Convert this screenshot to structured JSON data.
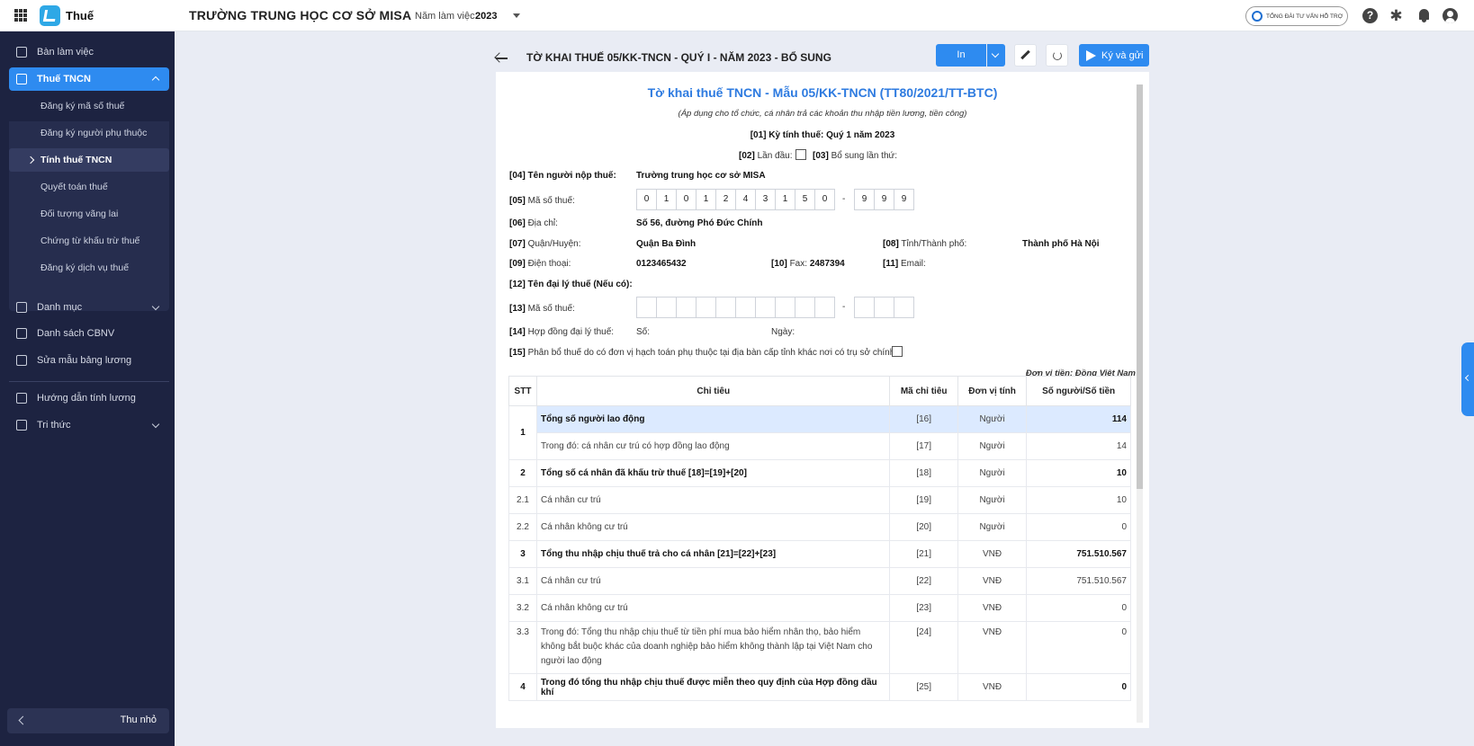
{
  "app": {
    "name": "Thuế",
    "school": "TRƯỜNG TRUNG HỌC CƠ SỞ MISA",
    "year_label": "Năm làm việc:",
    "year_value": "2023",
    "support_label": "TỔNG ĐÀI TƯ VẤN HỖ TRỢ"
  },
  "sidebar": {
    "items": [
      {
        "label": "Bàn làm việc",
        "icon": "dashboard-icon"
      },
      {
        "label": "Thuế TNCN",
        "icon": "tax-icon"
      },
      {
        "label": "Danh mục",
        "icon": "list-icon"
      },
      {
        "label": "Danh sách CBNV",
        "icon": "contacts-icon"
      },
      {
        "label": "Sửa mẫu bảng lương",
        "icon": "settings-doc-icon"
      },
      {
        "label": "Hướng dẫn tính lương",
        "icon": "guide-icon"
      },
      {
        "label": "Tri thức",
        "icon": "knowledge-icon"
      }
    ],
    "sub_items": [
      "Đăng ký mã số thuế",
      "Đăng ký người phụ thuộc",
      "Tính thuế TNCN",
      "Quyết toán thuế",
      "Đối tượng vãng lai",
      "Chứng từ khấu trừ thuế",
      "Đăng ký dịch vụ thuế"
    ],
    "collapse_label": "Thu nhỏ"
  },
  "page": {
    "title": "TỜ KHAI THUẾ 05/KK-TNCN - QUÝ I - NĂM 2023 - BỔ SUNG",
    "print_label": "In",
    "sign_label": "Ký và gửi"
  },
  "form": {
    "title": "Tờ khai thuế TNCN - Mẫu 05/KK-TNCN (TT80/2021/TT-BTC)",
    "subtitle": "(Áp dụng cho tổ chức, cá nhân trả các khoản thu nhập tiền lương, tiền công)",
    "f01_label": "[01] Kỳ tính thuế:",
    "f01_value": "Quý 1 năm 2023",
    "f02_code": "[02]",
    "f02_label": "Lần đầu:",
    "f03_code": "[03]",
    "f03_label": "Bổ sung lần thứ:",
    "f04_label": "[04] Tên người nộp thuế:",
    "f04_value": "Trường trung học cơ sở MISA",
    "f05_code": "[05]",
    "f05_label": "Mã số thuế:",
    "tax_code_digits": [
      "0",
      "1",
      "0",
      "1",
      "2",
      "4",
      "3",
      "1",
      "5",
      "0"
    ],
    "tax_code_suffix": [
      "9",
      "9",
      "9"
    ],
    "dash": "-",
    "f06_code": "[06]",
    "f06_label": "Địa chỉ:",
    "f06_value": "Số 56, đường Phó Đức Chính",
    "f07_code": "[07]",
    "f07_label": "Quận/Huyện:",
    "f07_value": "Quận Ba Đình",
    "f08_code": "[08]",
    "f08_label": "Tỉnh/Thành phố:",
    "f08_value": "Thành phố Hà Nội",
    "f09_code": "[09]",
    "f09_label": "Điện thoại:",
    "f09_value": "0123465432",
    "f10_code": "[10]",
    "f10_label": "Fax:",
    "f10_value": "2487394",
    "f11_code": "[11]",
    "f11_label": "Email:",
    "f12_label": "[12] Tên đại lý thuế (Nếu có):",
    "f13_code": "[13]",
    "f13_label": "Mã số thuế:",
    "f14_code": "[14]",
    "f14_label": "Hợp đồng đại lý thuế:",
    "f14_no": "Số:",
    "f14_date": "Ngày:",
    "f15_code": "[15]",
    "f15_label": "Phân bổ thuế do có đơn vị hạch toán phụ thuộc tại địa bàn cấp tỉnh khác nơi có trụ sở chính:",
    "currency_note": "Đơn vị tiền: Đồng Việt Nam"
  },
  "table": {
    "headers": [
      "STT",
      "Chỉ tiêu",
      "Mã chỉ tiêu",
      "Đơn vị tính",
      "Số người/Số tiền"
    ],
    "rows": [
      {
        "stt": "1",
        "name": "Tổng số người lao động",
        "code": "[16]",
        "unit": "Người",
        "value": "114"
      },
      {
        "stt": "",
        "name": "Trong đó: cá nhân cư trú có hợp đồng lao động",
        "code": "[17]",
        "unit": "Người",
        "value": "14"
      },
      {
        "stt": "2",
        "name": "Tổng số cá nhân đã khấu trừ thuế [18]=[19]+[20]",
        "code": "[18]",
        "unit": "Người",
        "value": "10"
      },
      {
        "stt": "2.1",
        "name": "Cá nhân cư trú",
        "code": "[19]",
        "unit": "Người",
        "value": "10"
      },
      {
        "stt": "2.2",
        "name": "Cá nhân không cư trú",
        "code": "[20]",
        "unit": "Người",
        "value": "0"
      },
      {
        "stt": "3",
        "name": "Tổng thu nhập chịu thuế trả cho cá nhân [21]=[22]+[23]",
        "code": "[21]",
        "unit": "VNĐ",
        "value": "751.510.567"
      },
      {
        "stt": "3.1",
        "name": "Cá nhân cư trú",
        "code": "[22]",
        "unit": "VNĐ",
        "value": "751.510.567"
      },
      {
        "stt": "3.2",
        "name": "Cá nhân không cư trú",
        "code": "[23]",
        "unit": "VNĐ",
        "value": "0"
      },
      {
        "stt": "3.3",
        "name": "Trong đó: Tổng thu nhập chịu thuế từ tiền phí mua bảo hiểm nhân thọ, bảo hiểm không bắt buộc khác của doanh nghiệp bảo hiểm không thành lập tại Việt Nam cho người lao động",
        "code": "[24]",
        "unit": "VNĐ",
        "value": "0"
      },
      {
        "stt": "4",
        "name": "Trong đó tổng thu nhập chịu thuế được miễn theo quy định của Hợp đồng dầu khí",
        "code": "[25]",
        "unit": "VNĐ",
        "value": "0"
      }
    ]
  },
  "colors": {
    "accent": "#2e8bf0",
    "sidebar_bg": "#1d2341",
    "title_blue": "#2e7be0",
    "row_highlight": "#dceaff"
  }
}
